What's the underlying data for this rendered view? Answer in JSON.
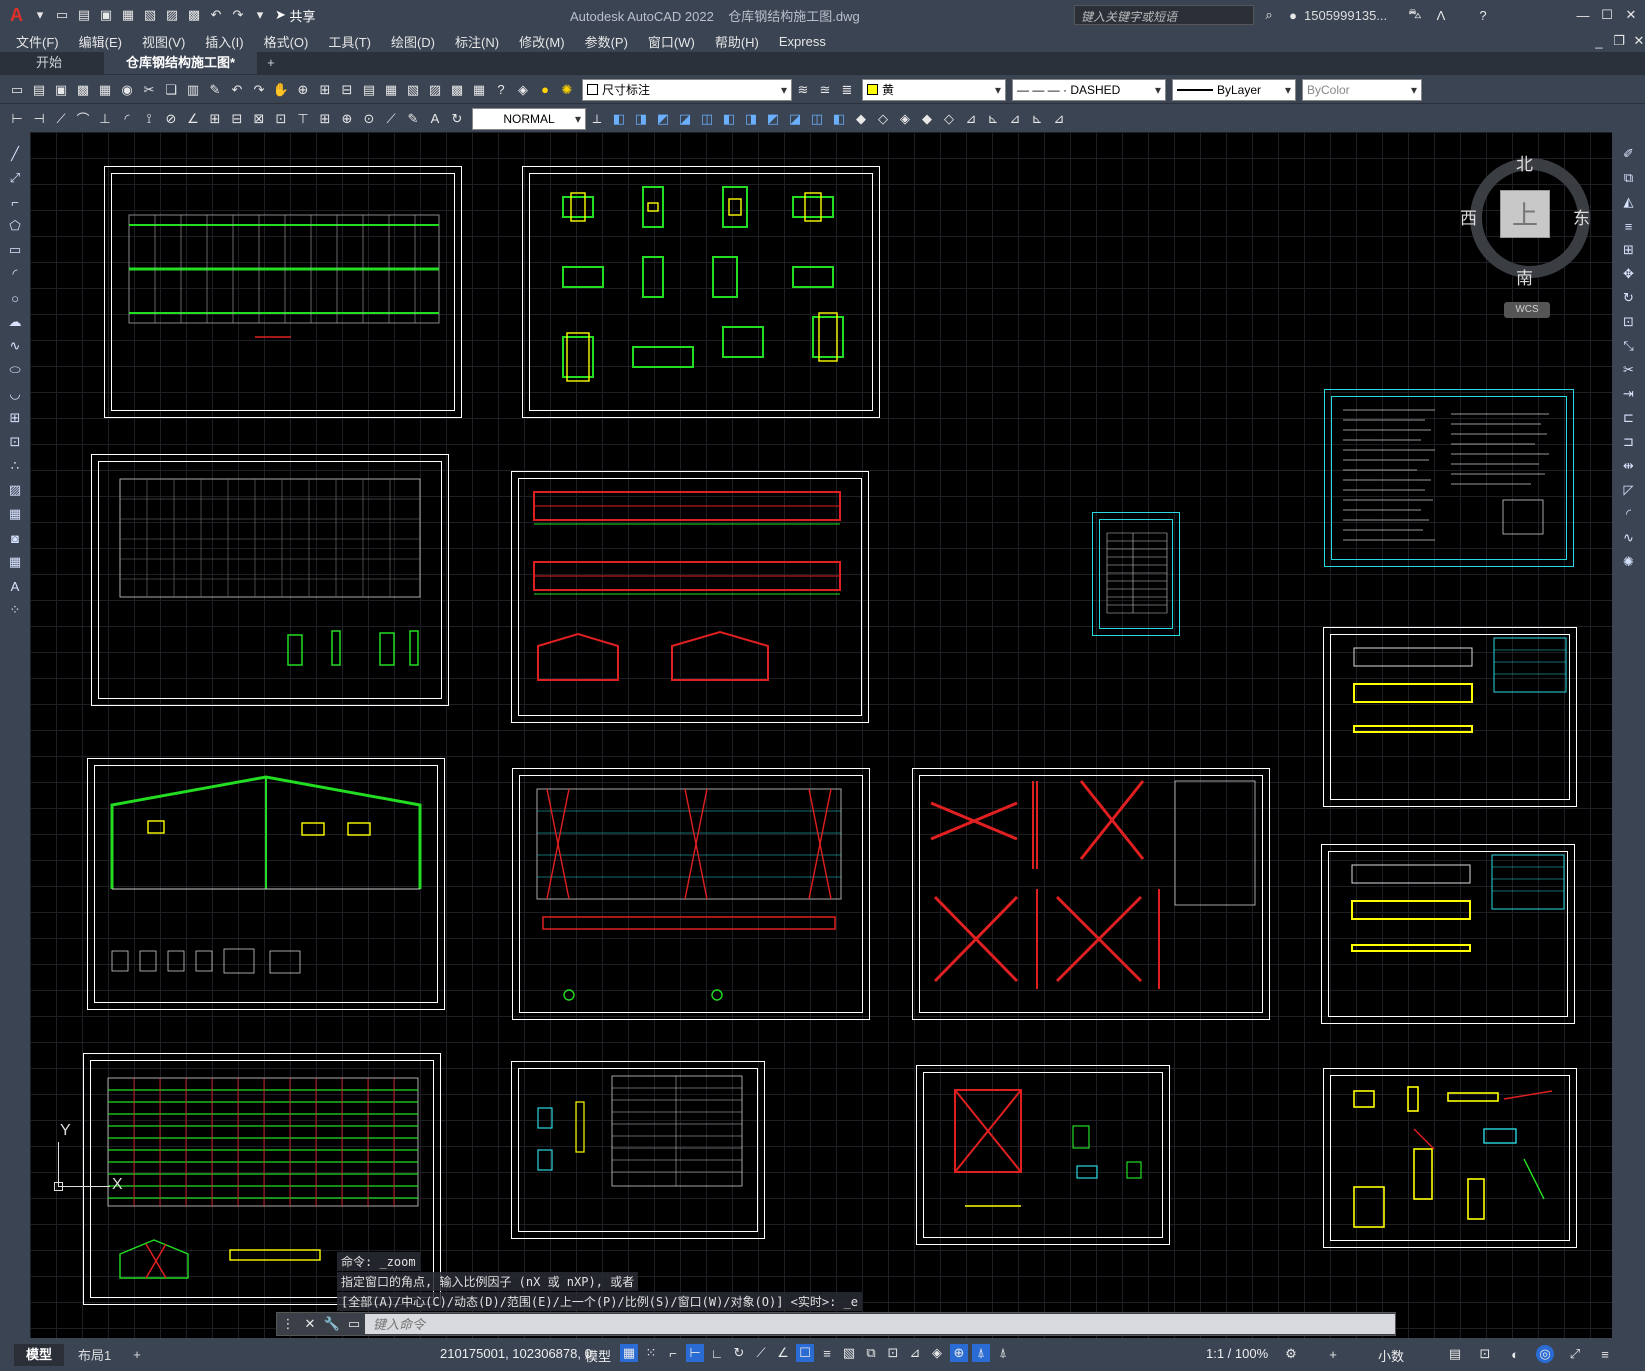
{
  "app": {
    "title": "Autodesk AutoCAD 2022",
    "file": "仓库钢结构施工图.dwg",
    "search_placeholder": "键入关键字或短语",
    "user": "1505999135...",
    "share": "共享"
  },
  "menu": [
    "文件(F)",
    "编辑(E)",
    "视图(V)",
    "插入(I)",
    "格式(O)",
    "工具(T)",
    "绘图(D)",
    "标注(N)",
    "修改(M)",
    "参数(P)",
    "窗口(W)",
    "帮助(H)",
    "Express"
  ],
  "tabs": {
    "start": "开始",
    "doc": "仓库钢结构施工图*",
    "add": "+"
  },
  "toolbar": {
    "layer": "尺寸标注",
    "color": "黄",
    "linetype": "— — — · DASHED",
    "lineweight": "ByLayer",
    "plotstyle": "ByColor",
    "textstyle": "NORMAL"
  },
  "viewcube": {
    "north": "北",
    "south": "南",
    "east": "东",
    "west": "西",
    "top": "上",
    "wcs": "WCS"
  },
  "ucs": {
    "y": "Y",
    "x": "X"
  },
  "command": {
    "line1": "命令: _zoom",
    "line2": "指定窗口的角点, 输入比例因子 (nX 或 nXP), 或者",
    "line3": "[全部(A)/中心(C)/动态(D)/范围(E)/上一个(P)/比例(S)/窗口(W)/对象(O)] <实时>: _e",
    "placeholder": "键入命令"
  },
  "status": {
    "model_tab": "模型",
    "layout_tab": "布局1",
    "coords": "210175001, 102306878, 0",
    "mode": "模型",
    "scale": "1:1 / 100%",
    "units": "小数"
  },
  "colors": {
    "accent": "#3b4453",
    "cyan": "#2bd7e0",
    "green": "#22dd22",
    "red": "#e02020",
    "yellow": "#ffff00"
  }
}
